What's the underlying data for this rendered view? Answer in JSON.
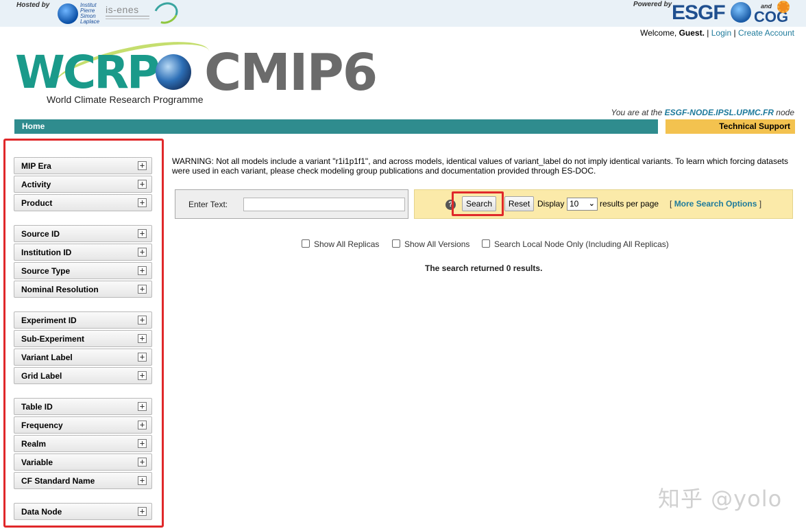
{
  "header": {
    "hosted_by": "Hosted by",
    "ipsl_line1": "Institut",
    "ipsl_line2": "Pierre",
    "ipsl_line3": "Simon",
    "ipsl_line4": "Laplace",
    "isenes": "is-enes",
    "powered_by": "Powered by",
    "esgf": "ESGF",
    "and": "and",
    "cog": "COG"
  },
  "welcome": {
    "prefix": "Welcome,",
    "user": "Guest.",
    "sep1": "|",
    "login": "Login",
    "sep2": "|",
    "create_account": "Create Account"
  },
  "banner": {
    "wcrp": "WCRP",
    "cmip6": "CMIP6",
    "subtitle": "World Climate Research Programme"
  },
  "node_info": {
    "prefix": "You are at the",
    "node": "ESGF-NODE.IPSL.UPMC.FR",
    "suffix": "node"
  },
  "nav": {
    "home": "Home",
    "tech_support": "Technical Support"
  },
  "facets": [
    {
      "label": "MIP Era"
    },
    {
      "label": "Activity"
    },
    {
      "label": "Product"
    },
    {
      "label": "Source ID"
    },
    {
      "label": "Institution ID"
    },
    {
      "label": "Source Type"
    },
    {
      "label": "Nominal Resolution"
    },
    {
      "label": "Experiment ID"
    },
    {
      "label": "Sub-Experiment"
    },
    {
      "label": "Variant Label"
    },
    {
      "label": "Grid Label"
    },
    {
      "label": "Table ID"
    },
    {
      "label": "Frequency"
    },
    {
      "label": "Realm"
    },
    {
      "label": "Variable"
    },
    {
      "label": "CF Standard Name"
    },
    {
      "label": "Data Node"
    }
  ],
  "facet_toggle": "+",
  "warning": "WARNING: Not all models include a variant \"r1i1p1f1\", and across models, identical values of variant_label do not imply identical variants. To learn which forcing datasets were used in each variant, please check modeling group publications and documentation provided through ES-DOC.",
  "search": {
    "enter_text_label": "Enter Text:",
    "enter_text_value": "",
    "help": "?",
    "search_button": "Search",
    "reset_button": "Reset",
    "display_label": "Display",
    "per_page": "10",
    "caret": "⌄",
    "per_page_suffix": "results per page",
    "more_open": "[",
    "more_options": "More Search Options",
    "more_close": "]"
  },
  "options": {
    "show_all_replicas": "Show All Replicas",
    "show_all_versions": "Show All Versions",
    "search_local": "Search Local Node Only (Including All Replicas)"
  },
  "result_message": "The search returned 0 results.",
  "watermark": "知乎 @yolo",
  "colors": {
    "nav_teal": "#2f8c8e",
    "support_yellow": "#f3c24f",
    "search_panel": "#fbeaa9",
    "highlight_red": "#e0282a",
    "link": "#1e7a9b"
  }
}
